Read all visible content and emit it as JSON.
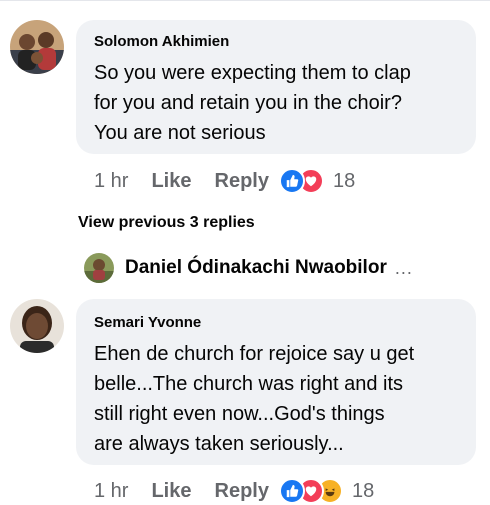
{
  "comments": [
    {
      "author": "Solomon Akhimien",
      "lines": [
        "So you were expecting them to clap",
        "for you and retain you in the choir?",
        "You are not serious"
      ],
      "time": "1 hr",
      "like_label": "Like",
      "reply_label": "Reply",
      "reactions": [
        "like",
        "love"
      ],
      "reaction_count": "18"
    },
    {
      "author": "Semari Yvonne",
      "lines": [
        "Ehen de church for rejoice say u get",
        "belle...The church was right and its",
        "still right even now...God's things",
        "are always taken seriously..."
      ],
      "time": "1 hr",
      "like_label": "Like",
      "reply_label": "Reply",
      "reactions": [
        "like",
        "love",
        "haha"
      ],
      "reaction_count": "18"
    }
  ],
  "view_previous_replies": "View previous 3 replies",
  "latest_reply": {
    "author": "Daniel Ódinakachi Nwaobilor",
    "more": "..."
  },
  "colors": {
    "bubble_bg": "#f0f2f5",
    "secondary_text": "#65676b",
    "like_blue": "#1877f2",
    "love_red": "#f33e58",
    "haha_yellow": "#f7b125"
  }
}
